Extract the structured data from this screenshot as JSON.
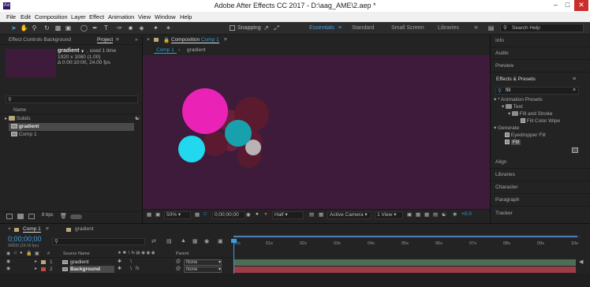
{
  "window": {
    "title": "Adobe After Effects CC 2017 - D:\\aag_AME\\2.aep *",
    "logo": "Ae"
  },
  "menu": [
    "File",
    "Edit",
    "Composition",
    "Layer",
    "Effect",
    "Animation",
    "View",
    "Window",
    "Help"
  ],
  "toolbar": {
    "snapping_label": "Snapping",
    "workspaces": [
      "Essentials",
      "Standard",
      "Small Screen",
      "Libraries"
    ],
    "active_workspace": "Essentials",
    "search_help_placeholder": "Search Help"
  },
  "project_panel": {
    "tab_effect_controls": "Effect Controls Background",
    "tab_project": "Project",
    "item_name": "gradient",
    "item_used": ", used 1 time",
    "item_size": "1920 x 1080 (1.00)",
    "item_duration": "Δ 0:00:10:00, 24.00 fps",
    "search_placeholder": "",
    "column_name": "Name",
    "items": [
      {
        "name": "Solids",
        "type": "folder"
      },
      {
        "name": "gradient",
        "type": "comp",
        "selected": true
      },
      {
        "name": "Comp 1",
        "type": "comp"
      }
    ],
    "bpc": "8 bpc"
  },
  "composition_panel": {
    "tab_label": "Composition",
    "comp_name": "Comp 1",
    "sub_tabs": [
      "Comp 1",
      "gradient"
    ],
    "background_color": "#3e1b3a",
    "viewer_controls": {
      "zoom": "50%",
      "time": "0;00;00;00",
      "resolution": "Half",
      "camera": "Active Camera",
      "views": "1 View",
      "exposure": "+0.0"
    }
  },
  "right_panels": {
    "info": "Info",
    "audio": "Audio",
    "preview": "Preview",
    "effects_presets": "Effects & Presets",
    "search_value": "fill",
    "tree": [
      {
        "label": "* Animation Presets",
        "level": 0,
        "expanded": true
      },
      {
        "label": "Text",
        "level": 1,
        "expanded": true
      },
      {
        "label": "Fill and Stroke",
        "level": 2,
        "expanded": true
      },
      {
        "label": "Fill Color Wipe",
        "level": 3
      },
      {
        "label": "Generate",
        "level": 0,
        "expanded": true
      },
      {
        "label": "Eyedropper Fill",
        "level": 1
      },
      {
        "label": "Fill",
        "level": 1,
        "selected": true
      }
    ],
    "collapsed": [
      "Align",
      "Libraries",
      "Character",
      "Paragraph",
      "Tracker"
    ]
  },
  "timeline": {
    "tabs": [
      "Comp 1",
      "gradient"
    ],
    "timecode": "0;00;00;00",
    "timecode_sub": "00000 (24.00 fps)",
    "columns": [
      "#",
      "Source Name",
      "Parent"
    ],
    "layers": [
      {
        "num": "1",
        "name": "gradient",
        "parent": "None",
        "label_color": "#b9a878",
        "bar": "green"
      },
      {
        "num": "2",
        "name": "Background",
        "parent": "None",
        "label_color": "#c24a4a",
        "bar": "red",
        "selected": true
      }
    ],
    "ruler": [
      "00s",
      "01s",
      "02s",
      "03s",
      "04s",
      "05s",
      "06s",
      "07s",
      "08s",
      "09s",
      "10s"
    ]
  }
}
